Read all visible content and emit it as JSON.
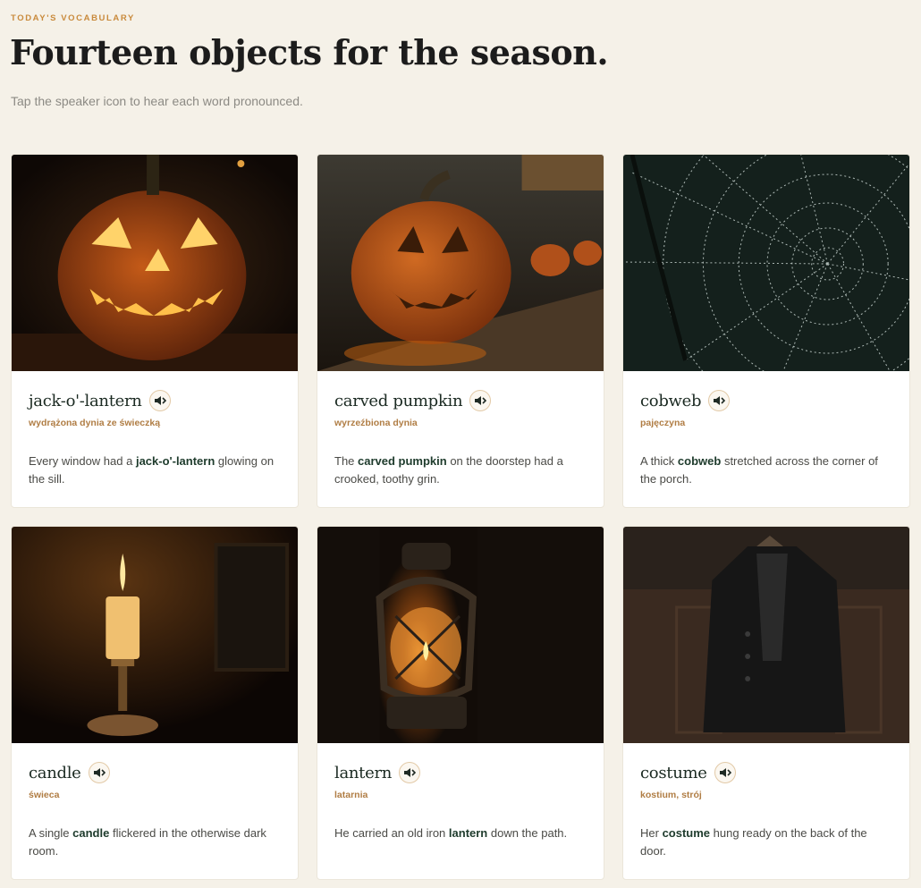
{
  "header": {
    "eyebrow": "TODAY'S VOCABULARY",
    "title": "Fourteen objects for the season.",
    "subtitle": "Tap the speaker icon to hear each word pronounced."
  },
  "cards": [
    {
      "word": "jack-o'-lantern",
      "translation": "wydrążona dynia ze świeczką",
      "sentence_before": "Every window had a ",
      "sentence_word": "jack-o'-lantern",
      "sentence_after": " glowing on the sill.",
      "image": "jack-o-lantern-photo"
    },
    {
      "word": "carved pumpkin",
      "translation": "wyrzeźbiona dynia",
      "sentence_before": "The ",
      "sentence_word": "carved pumpkin",
      "sentence_after": " on the doorstep had a crooked, toothy grin.",
      "image": "carved-pumpkin-photo"
    },
    {
      "word": "cobweb",
      "translation": "pajęczyna",
      "sentence_before": "A thick ",
      "sentence_word": "cobweb",
      "sentence_after": " stretched across the corner of the porch.",
      "image": "cobweb-photo"
    },
    {
      "word": "candle",
      "translation": "świeca",
      "sentence_before": "A single ",
      "sentence_word": "candle",
      "sentence_after": " flickered in the otherwise dark room.",
      "image": "candle-photo"
    },
    {
      "word": "lantern",
      "translation": "latarnia",
      "sentence_before": "He carried an old iron ",
      "sentence_word": "lantern",
      "sentence_after": " down the path.",
      "image": "lantern-photo"
    },
    {
      "word": "costume",
      "translation": "kostium, strój",
      "sentence_before": "Her ",
      "sentence_word": "costume",
      "sentence_after": " hung ready on the back of the door.",
      "image": "costume-photo"
    }
  ],
  "icons": {
    "speaker": "speaker-icon"
  },
  "colors": {
    "background": "#f5f1e8",
    "accent": "#c98a3c",
    "word": "#1b2a22",
    "translation": "#b07d44"
  }
}
